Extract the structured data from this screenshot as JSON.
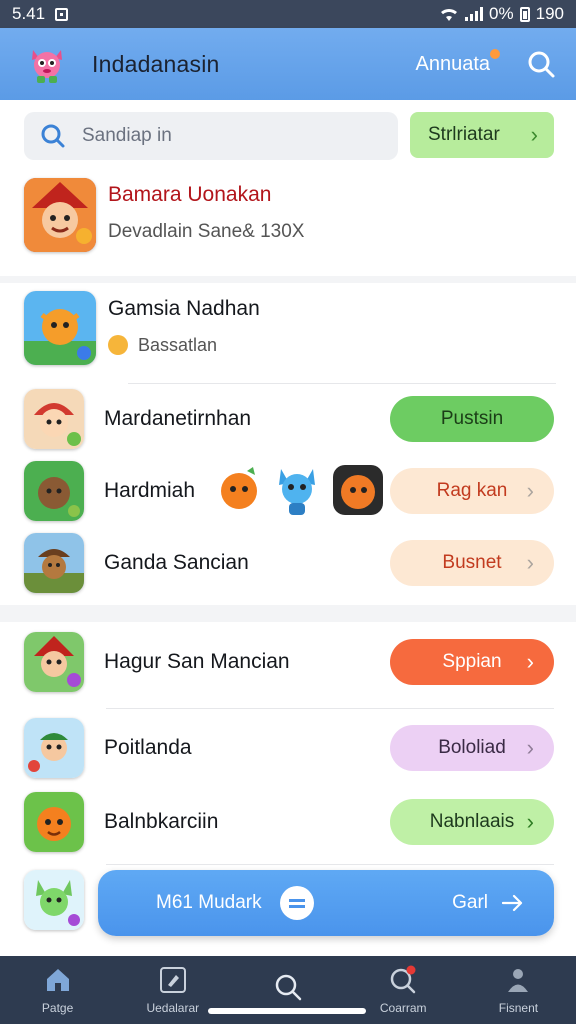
{
  "status": {
    "time": "5.41",
    "battery": "0%",
    "right_text": "190"
  },
  "appbar": {
    "title": "Indadanasin",
    "action": "Annuata"
  },
  "search": {
    "placeholder": "Sandiap in",
    "filter_label": "Strlriatar"
  },
  "featured": [
    {
      "name": "Bamara Uonakan",
      "subtitle": "Devadlain Sane& 130X",
      "accent": "#b2151b"
    },
    {
      "name": "Gamsia Nadhan",
      "subtitle": "Bassatlan"
    }
  ],
  "list1": [
    {
      "name": "Mardanetirnhan",
      "button": "Pustsin",
      "color": "#6dcc62",
      "text_color": "#1b3d17"
    },
    {
      "name": "Hardmiah",
      "button": "Rag kan",
      "color": "#fde8d3",
      "text_color": "#c23b1f"
    },
    {
      "name": "Ganda Sancian",
      "button": "Busnet",
      "color": "#fde8d3",
      "text_color": "#c23b1f"
    }
  ],
  "list2": [
    {
      "name": "Hagur San Mancian",
      "button": "Sppian",
      "color": "#f66a3e",
      "text_color": "#ffffff"
    },
    {
      "name": "Poitlanda",
      "button": "Bololiad",
      "color": "#ecd0f4",
      "text_color": "#3a2a45"
    },
    {
      "name": "Balnbkarciin",
      "button": "Nabnlaais",
      "color": "#bff0a6",
      "text_color": "#1e3a1e"
    }
  ],
  "fab": {
    "left": "M61 Mudark",
    "right": "Garl"
  },
  "nav": [
    {
      "label": "Patge",
      "icon": "home-icon"
    },
    {
      "label": "Uedalarar",
      "icon": "edit-icon"
    },
    {
      "label": "",
      "icon": "search-icon"
    },
    {
      "label": "Coarram",
      "icon": "search-notify-icon"
    },
    {
      "label": "Fisnent",
      "icon": "profile-icon"
    }
  ]
}
